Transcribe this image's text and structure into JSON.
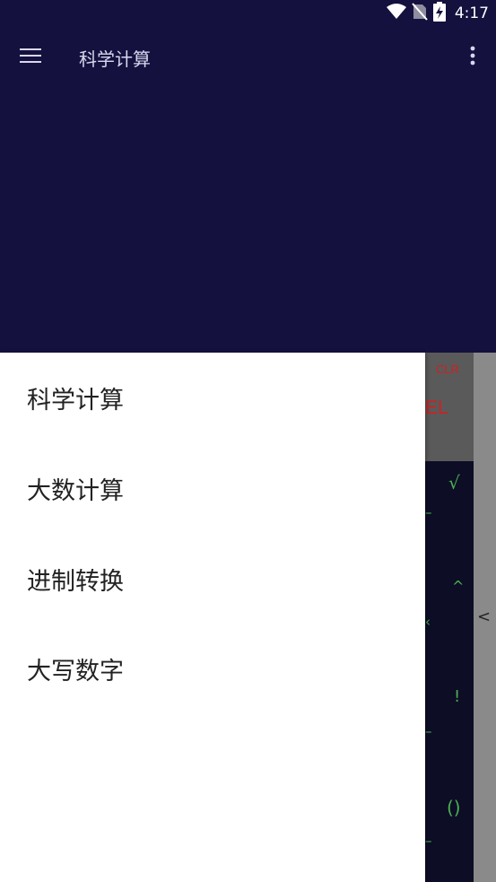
{
  "status_bar": {
    "time": "4:17",
    "icons": [
      "wifi-icon",
      "no-sim-icon",
      "battery-charging-icon"
    ]
  },
  "toolbar": {
    "title": "科学计算",
    "menu_icon": "hamburger-menu-icon",
    "more_icon": "more-vert-icon"
  },
  "drawer": {
    "items": [
      {
        "label": "科学计算"
      },
      {
        "label": "大数计算"
      },
      {
        "label": "进制转换"
      },
      {
        "label": "大写数字"
      }
    ]
  },
  "calc_peek": {
    "clr_label": "CLR",
    "del_label": "EL",
    "keys": [
      "√",
      "^",
      "!",
      "()"
    ],
    "side_chevron": "<"
  },
  "colors": {
    "header_bg": "#14113f",
    "drawer_bg": "#ffffff",
    "key_green": "#4caf50",
    "clr_red": "#d21f1f"
  }
}
